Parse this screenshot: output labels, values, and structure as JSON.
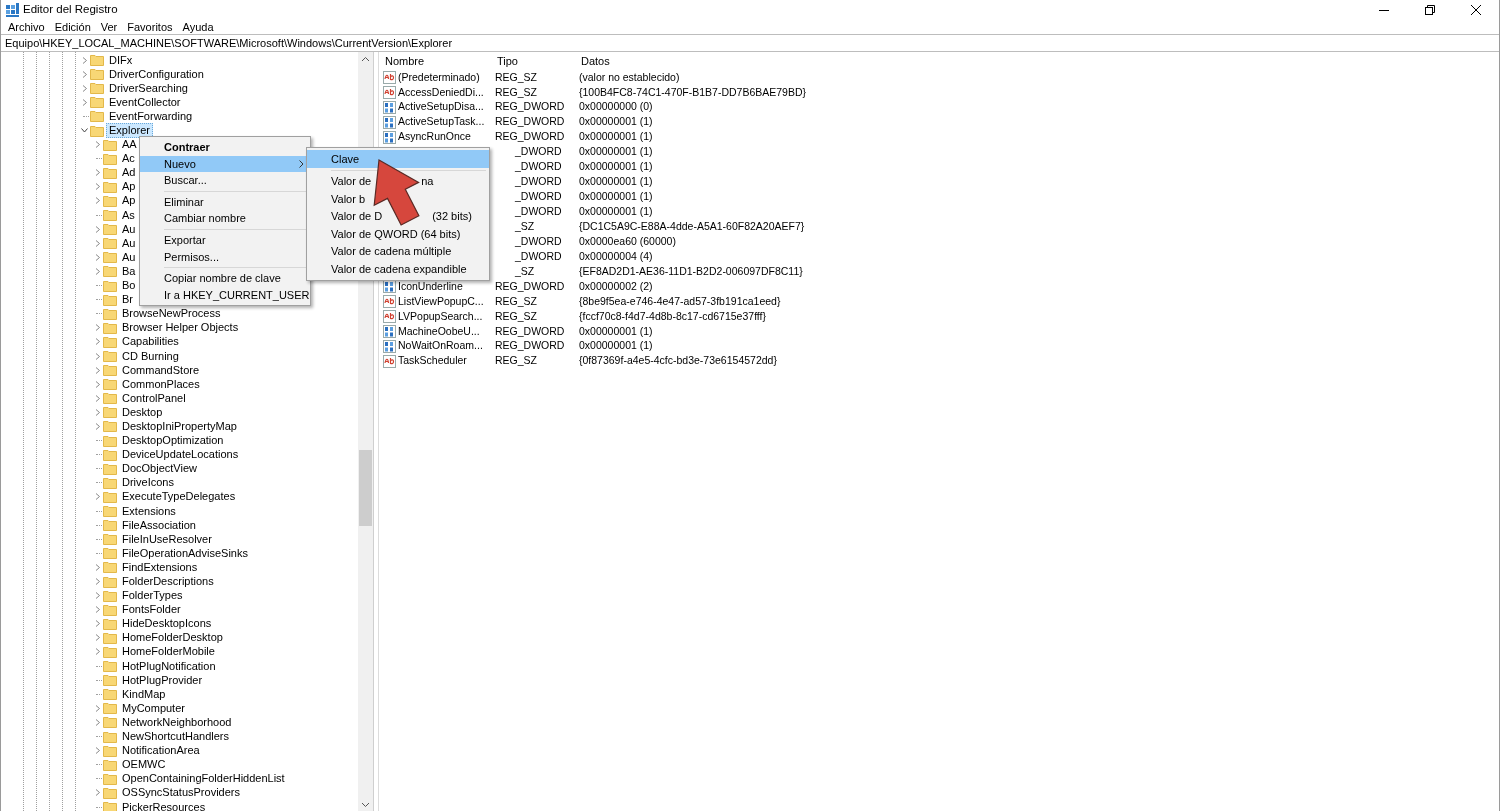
{
  "window": {
    "title": "Editor del Registro"
  },
  "menu_bar": [
    "Archivo",
    "Edición",
    "Ver",
    "Favoritos",
    "Ayuda"
  ],
  "address": "Equipo\\HKEY_LOCAL_MACHINE\\SOFTWARE\\Microsoft\\Windows\\CurrentVersion\\Explorer",
  "tree": {
    "items": [
      {
        "label": "DIFx",
        "expandable": true,
        "selected": false
      },
      {
        "label": "DriverConfiguration",
        "expandable": true,
        "selected": false
      },
      {
        "label": "DriverSearching",
        "expandable": true,
        "selected": false
      },
      {
        "label": "EventCollector",
        "expandable": true,
        "selected": false
      },
      {
        "label": "EventForwarding",
        "expandable": false,
        "selected": false
      },
      {
        "label": "Explorer",
        "expandable": true,
        "expanded": true,
        "selected": true,
        "children": [
          {
            "label": "AA",
            "expandable": true,
            "selected": false
          },
          {
            "label": "Ac",
            "expandable": false,
            "selected": false
          },
          {
            "label": "Ad",
            "expandable": true,
            "selected": false
          },
          {
            "label": "Ap",
            "expandable": true,
            "selected": false
          },
          {
            "label": "Ap",
            "expandable": true,
            "selected": false
          },
          {
            "label": "As",
            "expandable": false,
            "selected": false
          },
          {
            "label": "Au",
            "expandable": true,
            "selected": false
          },
          {
            "label": "Au",
            "expandable": true,
            "selected": false
          },
          {
            "label": "Au",
            "expandable": true,
            "selected": false
          },
          {
            "label": "Ba",
            "expandable": true,
            "selected": false
          },
          {
            "label": "Bo",
            "expandable": false,
            "selected": false
          },
          {
            "label": "Br",
            "expandable": false,
            "selected": false
          },
          {
            "label": "BrowseNewProcess",
            "expandable": false,
            "selected": false
          },
          {
            "label": "Browser Helper Objects",
            "expandable": true,
            "selected": false
          },
          {
            "label": "Capabilities",
            "expandable": true,
            "selected": false
          },
          {
            "label": "CD Burning",
            "expandable": true,
            "selected": false
          },
          {
            "label": "CommandStore",
            "expandable": true,
            "selected": false
          },
          {
            "label": "CommonPlaces",
            "expandable": true,
            "selected": false
          },
          {
            "label": "ControlPanel",
            "expandable": true,
            "selected": false
          },
          {
            "label": "Desktop",
            "expandable": true,
            "selected": false
          },
          {
            "label": "DesktopIniPropertyMap",
            "expandable": true,
            "selected": false
          },
          {
            "label": "DesktopOptimization",
            "expandable": false,
            "selected": false
          },
          {
            "label": "DeviceUpdateLocations",
            "expandable": false,
            "selected": false
          },
          {
            "label": "DocObjectView",
            "expandable": false,
            "selected": false
          },
          {
            "label": "DriveIcons",
            "expandable": false,
            "selected": false
          },
          {
            "label": "ExecuteTypeDelegates",
            "expandable": true,
            "selected": false
          },
          {
            "label": "Extensions",
            "expandable": false,
            "selected": false
          },
          {
            "label": "FileAssociation",
            "expandable": false,
            "selected": false
          },
          {
            "label": "FileInUseResolver",
            "expandable": false,
            "selected": false
          },
          {
            "label": "FileOperationAdviseSinks",
            "expandable": false,
            "selected": false
          },
          {
            "label": "FindExtensions",
            "expandable": true,
            "selected": false
          },
          {
            "label": "FolderDescriptions",
            "expandable": true,
            "selected": false
          },
          {
            "label": "FolderTypes",
            "expandable": true,
            "selected": false
          },
          {
            "label": "FontsFolder",
            "expandable": true,
            "selected": false
          },
          {
            "label": "HideDesktopIcons",
            "expandable": true,
            "selected": false
          },
          {
            "label": "HomeFolderDesktop",
            "expandable": true,
            "selected": false
          },
          {
            "label": "HomeFolderMobile",
            "expandable": true,
            "selected": false
          },
          {
            "label": "HotPlugNotification",
            "expandable": false,
            "selected": false
          },
          {
            "label": "HotPlugProvider",
            "expandable": false,
            "selected": false
          },
          {
            "label": "KindMap",
            "expandable": false,
            "selected": false
          },
          {
            "label": "MyComputer",
            "expandable": true,
            "selected": false
          },
          {
            "label": "NetworkNeighborhood",
            "expandable": true,
            "selected": false
          },
          {
            "label": "NewShortcutHandlers",
            "expandable": false,
            "selected": false
          },
          {
            "label": "NotificationArea",
            "expandable": true,
            "selected": false
          },
          {
            "label": "OEMWC",
            "expandable": false,
            "selected": false
          },
          {
            "label": "OpenContainingFolderHiddenList",
            "expandable": false,
            "selected": false
          },
          {
            "label": "OSSyncStatusProviders",
            "expandable": true,
            "selected": false
          },
          {
            "label": "PickerResources",
            "expandable": false,
            "selected": false
          }
        ]
      }
    ]
  },
  "values": {
    "columns": [
      "Nombre",
      "Tipo",
      "Datos"
    ],
    "rows": [
      {
        "kind": "sz",
        "name": "(Predeterminado)",
        "type": "REG_SZ",
        "data": "(valor no establecido)"
      },
      {
        "kind": "sz",
        "name": "AccessDeniedDi...",
        "type": "REG_SZ",
        "data": "{100B4FC8-74C1-470F-B1B7-DD7B6BAE79BD}"
      },
      {
        "kind": "dword",
        "name": "ActiveSetupDisa...",
        "type": "REG_DWORD",
        "data": "0x00000000 (0)"
      },
      {
        "kind": "dword",
        "name": "ActiveSetupTask...",
        "type": "REG_DWORD",
        "data": "0x00000001 (1)"
      },
      {
        "kind": "dword",
        "name": "AsyncRunOnce",
        "type": "REG_DWORD",
        "data": "0x00000001 (1)"
      },
      {
        "type": "_DWORD",
        "data": "0x00000001 (1)"
      },
      {
        "type": "_DWORD",
        "data": "0x00000001 (1)"
      },
      {
        "type": "_DWORD",
        "data": "0x00000001 (1)"
      },
      {
        "type": "_DWORD",
        "data": "0x00000001 (1)"
      },
      {
        "type": "_DWORD",
        "data": "0x00000001 (1)"
      },
      {
        "type": "_SZ",
        "data": "{DC1C5A9C-E88A-4dde-A5A1-60F82A20AEF7}"
      },
      {
        "type": "_DWORD",
        "data": "0x0000ea60 (60000)"
      },
      {
        "type": "_DWORD",
        "data": "0x00000004 (4)"
      },
      {
        "type": "_SZ",
        "data": "{EF8AD2D1-AE36-11D1-B2D2-006097DF8C11}"
      },
      {
        "kind": "dword",
        "name": "IconUnderline",
        "type": "REG_DWORD",
        "data": "0x00000002 (2)"
      },
      {
        "kind": "sz",
        "name": "ListViewPopupC...",
        "type": "REG_SZ",
        "data": "{8be9f5ea-e746-4e47-ad57-3fb191ca1eed}"
      },
      {
        "kind": "sz",
        "name": "LVPopupSearch...",
        "type": "REG_SZ",
        "data": "{fccf70c8-f4d7-4d8b-8c17-cd6715e37fff}"
      },
      {
        "kind": "dword",
        "name": "MachineOobeU...",
        "type": "REG_DWORD",
        "data": "0x00000001 (1)"
      },
      {
        "kind": "dword",
        "name": "NoWaitOnRoam...",
        "type": "REG_DWORD",
        "data": "0x00000001 (1)"
      },
      {
        "kind": "sz",
        "name": "TaskScheduler",
        "type": "REG_SZ",
        "data": "{0f87369f-a4e5-4cfc-bd3e-73e6154572dd}"
      }
    ]
  },
  "context_menu": {
    "items": [
      {
        "kind": "item",
        "label": "Contraer",
        "default": true,
        "selected": false
      },
      {
        "kind": "item",
        "label": "Nuevo",
        "default": false,
        "selected": true,
        "submenu": true
      },
      {
        "kind": "item",
        "label": "Buscar...",
        "default": false,
        "selected": false
      },
      {
        "kind": "separator"
      },
      {
        "kind": "item",
        "label": "Eliminar",
        "default": false,
        "selected": false
      },
      {
        "kind": "item",
        "label": "Cambiar nombre",
        "default": false,
        "selected": false
      },
      {
        "kind": "separator"
      },
      {
        "kind": "item",
        "label": "Exportar",
        "default": false,
        "selected": false
      },
      {
        "kind": "item",
        "label": "Permisos...",
        "default": false,
        "selected": false
      },
      {
        "kind": "separator"
      },
      {
        "kind": "item",
        "label": "Copiar nombre de clave",
        "default": false,
        "selected": false
      },
      {
        "kind": "item",
        "label": "Ir a HKEY_CURRENT_USER",
        "default": false,
        "selected": false
      }
    ]
  },
  "submenu": {
    "items": [
      {
        "kind": "item",
        "parts": [
          "Clave"
        ],
        "selected": true
      },
      {
        "kind": "separator"
      },
      {
        "kind": "item",
        "parts": [
          "Valor de",
          "na"
        ],
        "selected": false
      },
      {
        "kind": "item",
        "parts": [
          "Valor b"
        ],
        "selected": false
      },
      {
        "kind": "item",
        "parts": [
          "Valor de D",
          "(32 bits)"
        ],
        "selected": false
      },
      {
        "kind": "item",
        "parts": [
          "Valor de QWORD (64 bits)"
        ],
        "selected": false
      },
      {
        "kind": "item",
        "parts": [
          "Valor de cadena múltiple"
        ],
        "selected": false
      },
      {
        "kind": "item",
        "parts": [
          "Valor de cadena expandible"
        ],
        "selected": false
      }
    ]
  }
}
